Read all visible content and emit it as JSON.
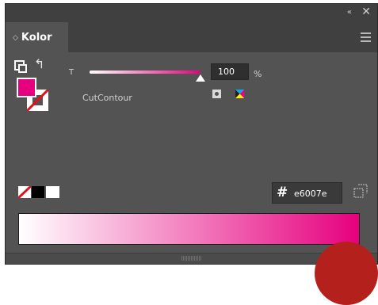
{
  "window": {
    "collapse_glyph": "«",
    "close_glyph": "✕"
  },
  "tab": {
    "chevron": "◇",
    "label": "Kolor"
  },
  "fill_stroke": {
    "fill_color": "#e6007e",
    "stroke": "none"
  },
  "tint": {
    "label": "T",
    "value": "100",
    "unit": "%",
    "level": 1.0
  },
  "color_name": "CutContour",
  "hex": {
    "symbol": "#",
    "value": "e6007e"
  },
  "ramp": {
    "start_color": "#ffffff",
    "end_color": "#e6007e"
  },
  "icons": [
    "fill-stroke-default-icon",
    "swap-arrow-icon",
    "spot-color-icon",
    "process-color-icon",
    "none-swatch-icon",
    "black-swatch-icon",
    "white-swatch-icon",
    "add-swatch-cube-icon",
    "panel-menu-icon"
  ]
}
